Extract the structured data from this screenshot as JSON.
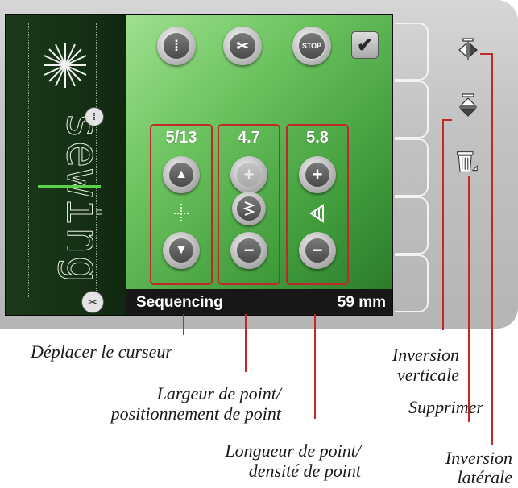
{
  "colors": {
    "accent_red": "#c0282a",
    "screen_green": "#6cc35f",
    "status_bar": "#171717"
  },
  "preview": {
    "word": "sewing",
    "icons": [
      "stitch-width-icon",
      "scissors-icon"
    ]
  },
  "toolbar": {
    "buttons": [
      {
        "name": "stitch-options-icon",
        "label": "⁞"
      },
      {
        "name": "scissors-icon",
        "label": "✂"
      },
      {
        "name": "stop-icon",
        "label": "STOP"
      },
      {
        "name": "checkmark-icon",
        "label": "✔"
      }
    ]
  },
  "groups": {
    "cursor": {
      "value": "5/13",
      "up": "▲",
      "down": "▼",
      "icon": "cursor-move-icon"
    },
    "width": {
      "value": "4.7",
      "plus": "+",
      "minus": "−",
      "icon": "zigzag-icon",
      "plus_disabled": true
    },
    "length": {
      "value": "5.8",
      "plus": "+",
      "minus": "−",
      "icon": "density-triangle-icon"
    }
  },
  "status": {
    "mode": "Sequencing",
    "length": "59 mm"
  },
  "side": {
    "icons": [
      "mirror-side-icon",
      "mirror-vertical-icon",
      "trash-icon"
    ],
    "tabs": 5
  },
  "captions": {
    "move_cursor": "Déplacer le curseur",
    "width_line1": "Largeur de point/",
    "width_line2": "positionnement de point",
    "length_line1": "Longueur de point/",
    "length_line2": "densité de point",
    "vertical_line1": "Inversion",
    "vertical_line2": "verticale",
    "delete": "Supprimer",
    "lateral_line1": "Inversion",
    "lateral_line2": "latérale"
  }
}
